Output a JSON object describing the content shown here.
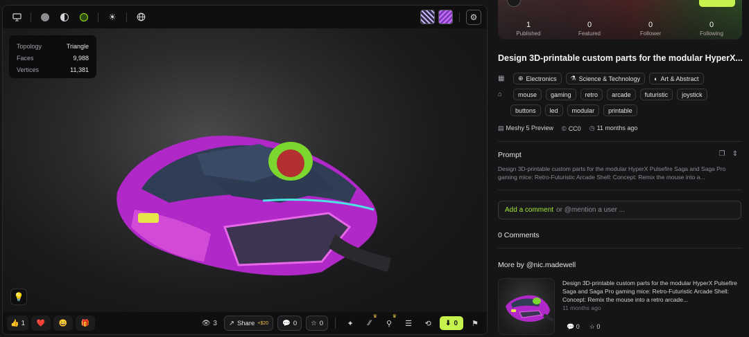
{
  "viewer": {
    "stats": {
      "topology_label": "Topology",
      "topology_value": "Triangle",
      "faces_label": "Faces",
      "faces_value": "9,988",
      "vertices_label": "Vertices",
      "vertices_value": "11,381"
    },
    "reactions": [
      {
        "icon": "👍",
        "count": "1"
      },
      {
        "icon": "❤️",
        "count": ""
      },
      {
        "icon": "😄",
        "count": ""
      },
      {
        "icon": "🎁",
        "count": ""
      }
    ],
    "views_count": "3",
    "share_label": "Share",
    "share_credit": "+$20",
    "comments_count": "0",
    "stars_count": "0",
    "downloads_count": "0"
  },
  "profile": {
    "published_count": "1",
    "published_label": "Published",
    "featured_count": "0",
    "featured_label": "Featured",
    "follower_count": "0",
    "follower_label": "Follower",
    "following_count": "0",
    "following_label": "Following"
  },
  "model": {
    "title": "Design 3D-printable custom parts for the modular HyperX...",
    "categories": [
      "Electronics",
      "Science & Technology",
      "Art & Abstract"
    ],
    "tags_row1": [
      "mouse",
      "gaming",
      "retro",
      "arcade",
      "futuristic",
      "joystick"
    ],
    "tags_row2": [
      "buttons",
      "led",
      "modular",
      "printable"
    ],
    "generator": "Meshy 5 Preview",
    "license": "CC0",
    "age": "11 months ago"
  },
  "prompt": {
    "heading": "Prompt",
    "text": "Design 3D-printable custom parts for the modular HyperX Pulsefire Saga and Saga Pro gaming mice: Retro-Futuristic Arcade Shell: Concept: Remix the mouse into a..."
  },
  "comments": {
    "add_label": "Add a comment",
    "placeholder_rest": "or @mention a user ...",
    "count_text": "0 Comments"
  },
  "more": {
    "heading": "More by @nic.madewell",
    "card_text": "Design 3D-printable custom parts for the modular HyperX Pulsefire Saga and Saga Pro gaming mice: Retro-Futuristic Arcade Shell: Concept: Remix the mouse into a retro arcade...",
    "card_time": "11 months ago",
    "card_comments": "0",
    "card_stars": "0"
  },
  "colors": {
    "accent": "#c6f24e",
    "link": "#a3e635"
  }
}
